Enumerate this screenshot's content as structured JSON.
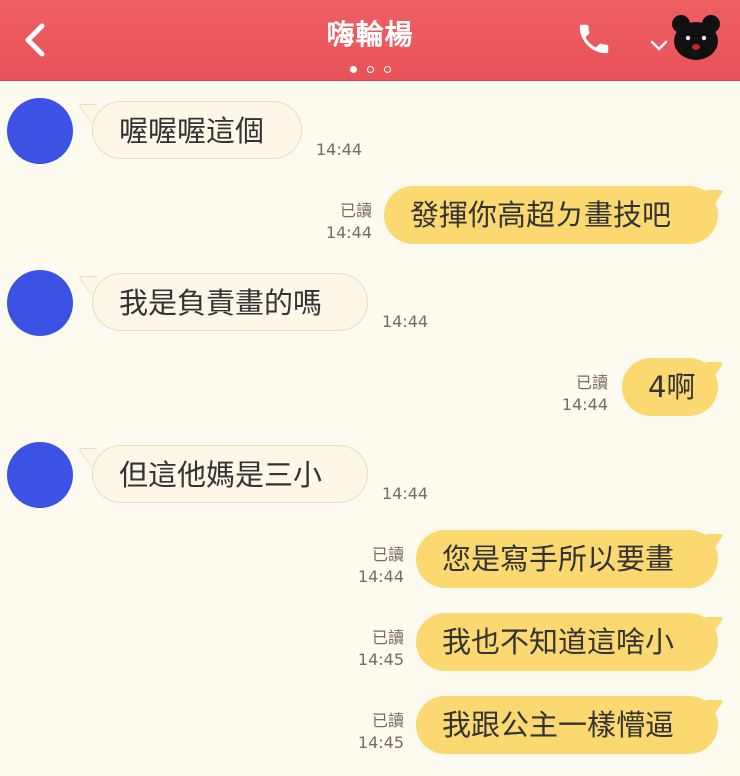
{
  "header": {
    "title": "嗨輪楊",
    "colors": {
      "bar": "#ec5a5f",
      "text": "#ffffff"
    }
  },
  "messages": [
    {
      "side": "in",
      "text": "喔喔喔這個",
      "time": "14:44"
    },
    {
      "side": "out",
      "text": "發揮你高超ㄉ畫技吧",
      "read": "已讀",
      "time": "14:44"
    },
    {
      "side": "in",
      "text": "我是負責畫的嗎",
      "time": "14:44"
    },
    {
      "side": "out",
      "text": "4啊",
      "read": "已讀",
      "time": "14:44"
    },
    {
      "side": "in",
      "text": "但這他媽是三小",
      "time": "14:44"
    },
    {
      "side": "out",
      "text": "您是寫手所以要畫",
      "read": "已讀",
      "time": "14:44"
    },
    {
      "side": "out",
      "text": "我也不知道這啥小",
      "read": "已讀",
      "time": "14:45"
    },
    {
      "side": "out",
      "text": "我跟公主一樣懵逼",
      "read": "已讀",
      "time": "14:45"
    }
  ],
  "colors": {
    "background": "#fdfaf0",
    "outgoing_bubble": "#fbd970",
    "incoming_bubble": "#fcf7e6",
    "avatar": "#3c52e4"
  }
}
